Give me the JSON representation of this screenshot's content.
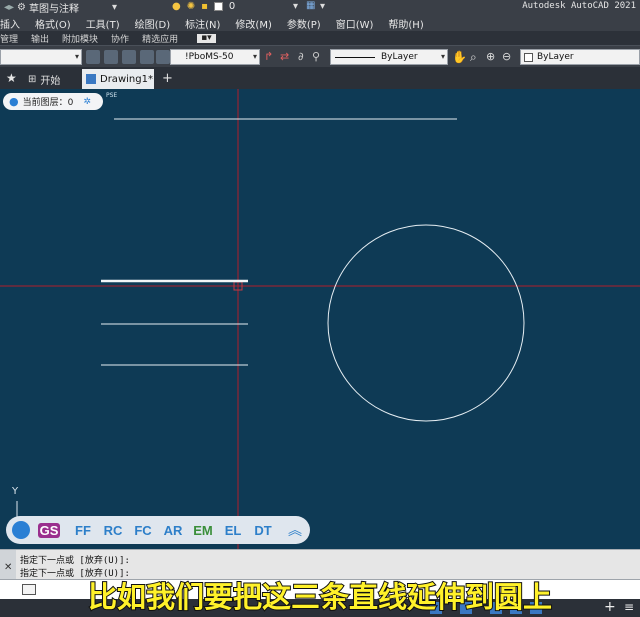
{
  "titlebar": {
    "workspace": "草图与注释",
    "layer_value": "0",
    "app_name": "Autodesk AutoCAD 2021"
  },
  "menubar": {
    "items": [
      "插入",
      "格式(O)",
      "工具(T)",
      "绘图(D)",
      "标注(N)",
      "修改(M)",
      "参数(P)",
      "窗口(W)",
      "帮助(H)"
    ]
  },
  "ribbon": {
    "items": [
      "管理",
      "输出",
      "附加模块",
      "协作",
      "精选应用"
    ]
  },
  "properties": {
    "dimstyle": "!PboMS-50",
    "linetype": "ByLayer",
    "color": "ByLayer"
  },
  "tabs": {
    "start_label": "开始",
    "drawing_label": "Drawing1*"
  },
  "canvas": {
    "current_layer_label": "当前图层：0",
    "pse_label": "PSE",
    "ucs_y_label": "Y",
    "background_color": "#0e3a55",
    "line_color": "#e6eef3",
    "crosshair_color": "#b01e2a"
  },
  "command_bar": {
    "items": [
      "GS",
      "FF",
      "RC",
      "FC",
      "AR",
      "EM",
      "EL",
      "DT"
    ]
  },
  "command_history": {
    "line1": "指定下一点或 [放弃(U)]:",
    "line2": "指定下一点或 [放弃(U)]:"
  },
  "caption": "比如我们要把这三条直线延伸到圆上"
}
